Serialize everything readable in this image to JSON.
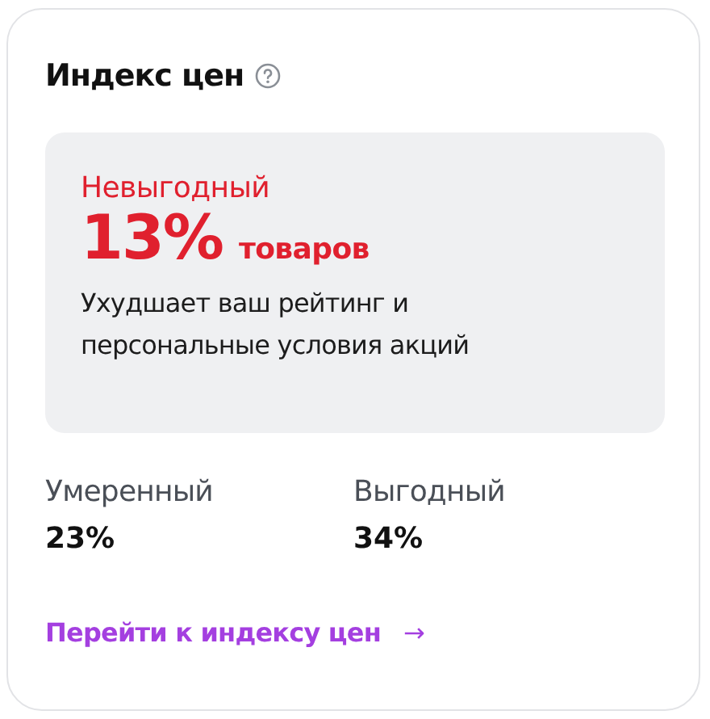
{
  "title": "Индекс цен",
  "highlight": {
    "label": "Невыгодный",
    "percent": "13%",
    "unit": "товаров",
    "description": "Ухудшает ваш рейтинг и персональные условия акций"
  },
  "stats": [
    {
      "label": "Умеренный",
      "value": "23%"
    },
    {
      "label": "Выгодный",
      "value": "34%"
    }
  ],
  "link": {
    "label": "Перейти к индексу цен",
    "arrow": "→"
  }
}
